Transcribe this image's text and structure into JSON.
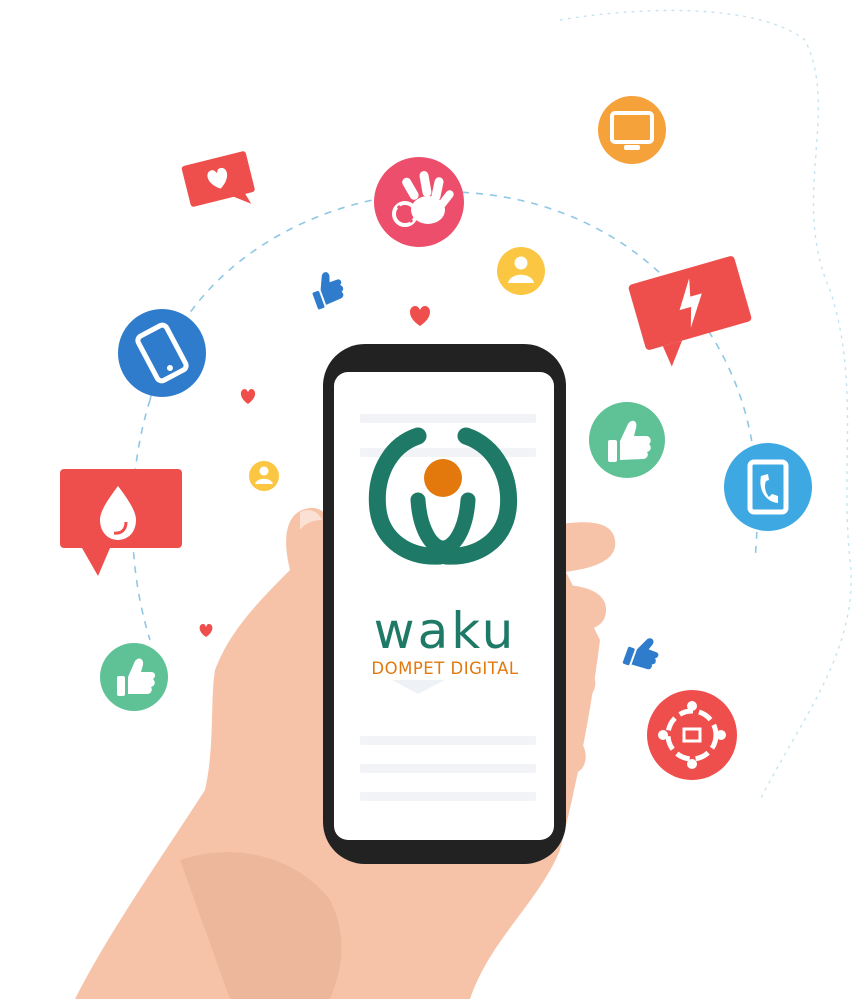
{
  "brand": {
    "name": "waku",
    "tagline": "DOMPET DIGITAL"
  },
  "colors": {
    "brand_teal": "#1e7a66",
    "brand_orange": "#e3780c",
    "accent_red": "#ef4f4c",
    "accent_pink": "#ec4e6b",
    "accent_blue": "#2f7ccc",
    "accent_sky": "#3ea8e3",
    "accent_green": "#5ec296",
    "accent_yellow": "#fbc743",
    "skin": "#f6c3a9",
    "phone_body": "#222222",
    "orbit_line": "#8fc8e6"
  },
  "icons": [
    "heart-chat-bubble-icon",
    "hand-wave-icon",
    "tv-monitor-icon",
    "user-badge-icon",
    "lightning-chat-bubble-icon",
    "thumbs-up-icon",
    "mobile-phone-icon",
    "telephone-icon",
    "water-drop-chat-bubble-icon",
    "recycle-people-icon",
    "heart-icon"
  ]
}
